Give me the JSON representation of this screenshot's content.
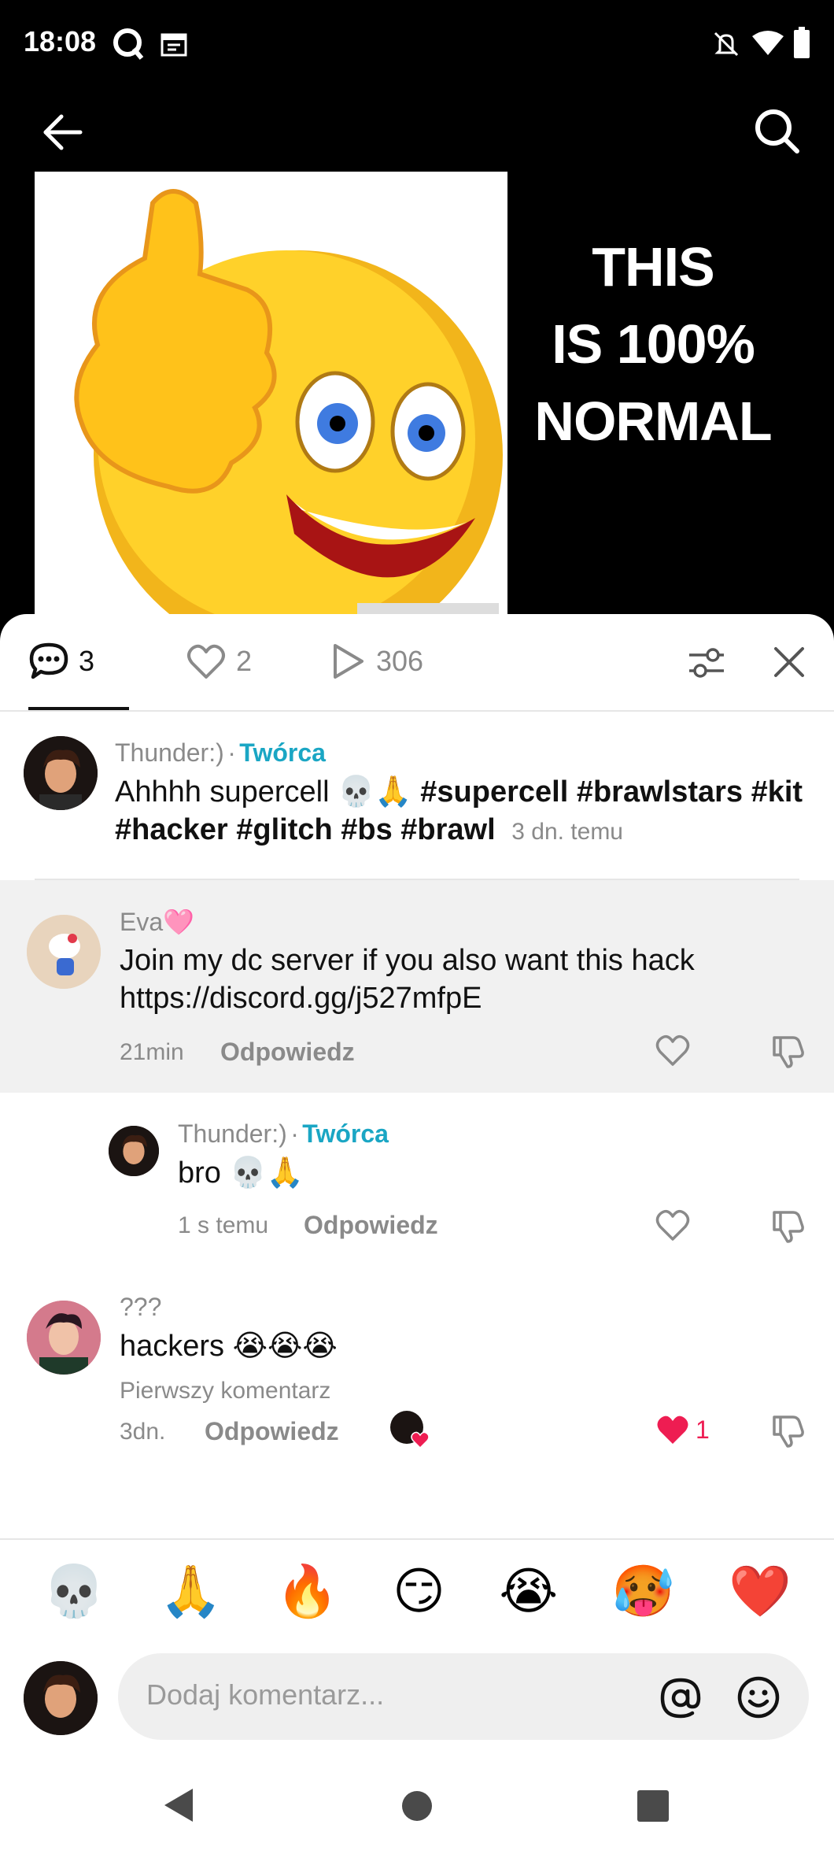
{
  "status_bar": {
    "time": "18:08"
  },
  "header": {
    "back_icon": "arrow-left-icon",
    "search_icon": "search-icon"
  },
  "video": {
    "overlay_lines": [
      "THIS",
      "IS 100%",
      "NORMAL"
    ]
  },
  "tabs": {
    "comments_count": "3",
    "likes_count": "2",
    "views_count": "306"
  },
  "caption": {
    "username": "Thunder:)",
    "separator": "·",
    "creator_label": "Twórca",
    "text": "Ahhhh supercell 💀🙏 ",
    "hashtags": "#supercell #brawlstars #kit #hacker #glitch #bs #brawl",
    "time": "3 dn. temu"
  },
  "comments": [
    {
      "username": "Eva🩷",
      "text_line1": "Join my dc server if you also want this hack",
      "text_line2": "https://discord.gg/j527mfpE",
      "time": "21min",
      "reply_label": "Odpowiedz"
    },
    {
      "username": "Thunder:)",
      "separator": "·",
      "creator_label": "Twórca",
      "text": "bro 💀🙏",
      "time": "1 s temu",
      "reply_label": "Odpowiedz"
    },
    {
      "username": "???",
      "text": "hackers 😭😭😭",
      "badge": "Pierwszy komentarz",
      "time": "3dn.",
      "reply_label": "Odpowiedz",
      "like_count": "1"
    }
  ],
  "emoji_bar": [
    "💀",
    "🙏",
    "🔥",
    "😏",
    "😭",
    "🥵",
    "❤️"
  ],
  "comment_input": {
    "placeholder": "Dodaj komentarz..."
  },
  "colors": {
    "accent": "#1aa6c4",
    "like_red": "#ee1d52",
    "sheet_bg": "#ffffff",
    "highlight_bg": "#f1f1f1"
  }
}
